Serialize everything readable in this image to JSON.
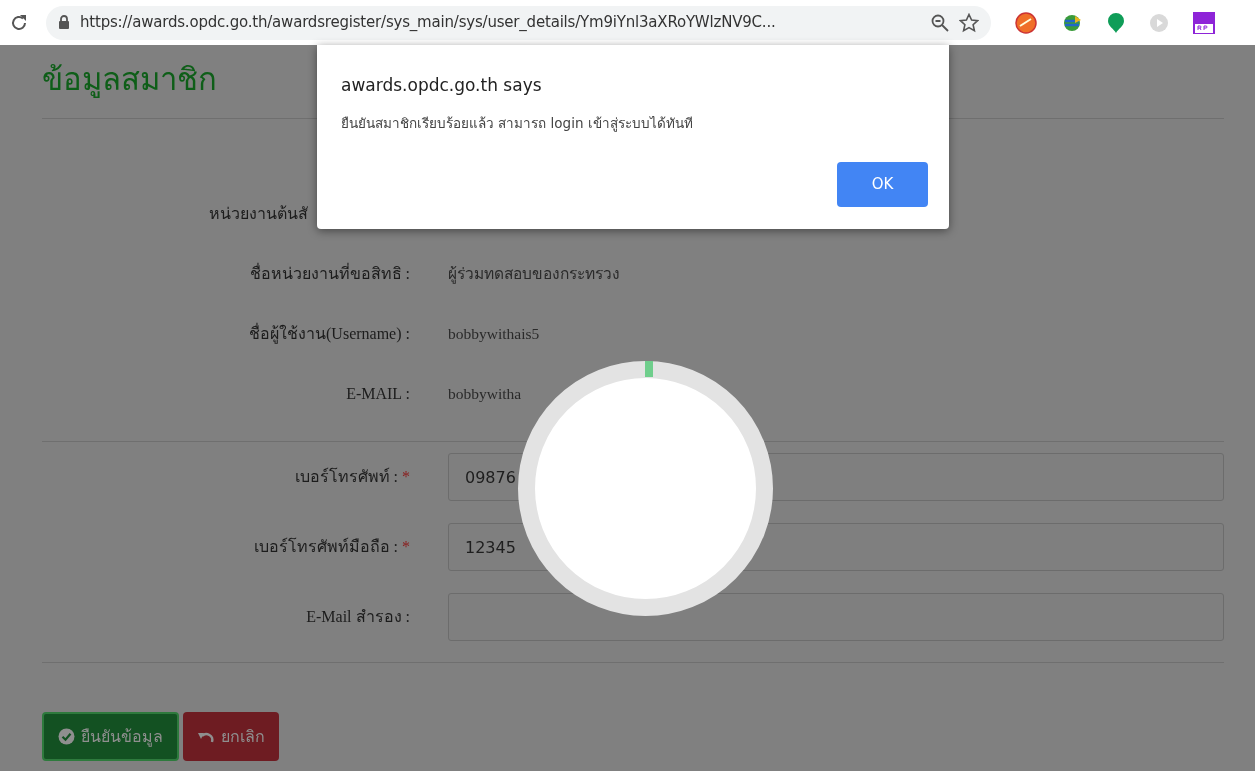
{
  "browser": {
    "url": "https://awards.opdc.go.th/awardsregister/sys_main/sys/user_details/Ym9iYnl3aXRoYWlzNV9C..."
  },
  "page": {
    "title": "ข้อมูลสมาชิก",
    "info_rows": [
      {
        "label": "หน่วยงานต้นสั"
      },
      {
        "label": "ชื่อหน่วยงานที่ขอสิทธิ :",
        "value": "ผู้ร่วมทดสอบของกระทรวง"
      },
      {
        "label": "ชื่อผู้ใช้งาน(Username) :",
        "value": "bobbywithais5"
      },
      {
        "label": "E-MAIL :",
        "value": "bobbywitha"
      }
    ],
    "required_mark": "*",
    "fields": [
      {
        "label": "เบอร์โทรศัพท์ :",
        "required": true,
        "value": "09876"
      },
      {
        "label": "เบอร์โทรศัพท์มือถือ :",
        "required": true,
        "value": "12345"
      },
      {
        "label": "E-Mail สำรอง :",
        "required": false
      }
    ],
    "buttons": [
      {
        "kind": "confirm",
        "label": "ยืนยันข้อมูล"
      },
      {
        "kind": "cancel",
        "label": "ยกเลิก"
      }
    ]
  },
  "dialog": {
    "title": "awards.opdc.go.th says",
    "message": "ยืนยันสมาชิกเรียบร้อยแล้ว สามารถ login เข้าสู่ระบบได้ทันที",
    "button": "OK"
  }
}
